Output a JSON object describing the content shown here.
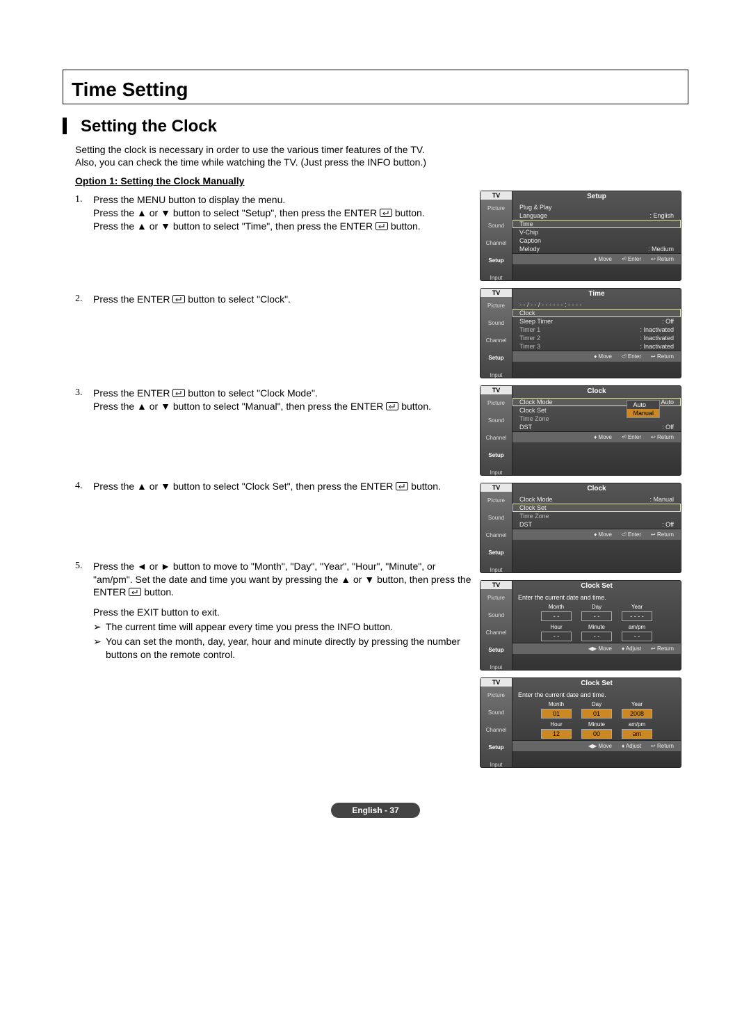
{
  "header": {
    "title": "Time Setting"
  },
  "subheader": {
    "title": "Setting the Clock"
  },
  "intro": {
    "line1": "Setting the clock is necessary in order to use the various timer features of the TV.",
    "line2": "Also, you can check the time while watching the TV. (Just press the INFO button.)"
  },
  "option1": {
    "title": "Option 1: Setting the Clock Manually"
  },
  "steps": {
    "s1": {
      "n": "1.",
      "a": "Press the MENU button to display the menu.",
      "b1": "Press the ▲ or ▼ button to select \"Setup\", then press the ENTER",
      "b2": "button.",
      "c1": "Press the ▲ or ▼ button to select \"Time\", then press the ENTER",
      "c2": "button."
    },
    "s2": {
      "n": "2.",
      "a1": "Press the ENTER",
      "a2": "button to select \"Clock\"."
    },
    "s3": {
      "n": "3.",
      "a1": "Press the ENTER",
      "a2": "button to select \"Clock Mode\".",
      "b1": "Press the ▲ or ▼ button to select \"Manual\", then press the ENTER",
      "b2": "button."
    },
    "s4": {
      "n": "4.",
      "a1": "Press the ▲ or ▼ button to select \"Clock Set\", then press the ENTER",
      "a2": "button."
    },
    "s5": {
      "n": "5.",
      "a": "Press the ◄ or ► button to move to \"Month\", \"Day\", \"Year\", \"Hour\", \"Minute\", or \"am/pm\". Set the date and time you want by pressing the ▲ or ▼ button, then press the ENTER",
      "a2": "button.",
      "b": "Press the EXIT button to exit.",
      "n1": "The current time will appear every time you press the INFO button.",
      "n2": "You can set the month, day, year, hour and minute directly by pressing the number buttons on the remote control."
    }
  },
  "osd": {
    "nav": {
      "tv": "TV",
      "tabs": [
        "Picture",
        "Sound",
        "Channel",
        "Setup",
        "Input"
      ],
      "sel_setup": 3
    },
    "foot": {
      "move": "Move",
      "enter": "Enter",
      "return": "Return",
      "adjust": "Adjust"
    },
    "setup": {
      "title": "Setup",
      "rows": [
        {
          "k": "Plug & Play",
          "v": "",
          "sel": false
        },
        {
          "k": "Language",
          "v": ": English",
          "sel": false
        },
        {
          "k": "Time",
          "v": "",
          "sel": true
        },
        {
          "k": "V-Chip",
          "v": "",
          "sel": false
        },
        {
          "k": "Caption",
          "v": "",
          "sel": false
        },
        {
          "k": "Melody",
          "v": ": Medium",
          "sel": false
        }
      ]
    },
    "time": {
      "title": "Time",
      "header": "- - / - - / - - - -   - - : - -   - -",
      "rows": [
        {
          "k": "Clock",
          "v": "",
          "sel": true
        },
        {
          "k": "Sleep Timer",
          "v": ": Off",
          "sel": false
        },
        {
          "k": "Timer 1",
          "v": ": Inactivated",
          "sel": false,
          "dim": true
        },
        {
          "k": "Timer 2",
          "v": ": Inactivated",
          "sel": false,
          "dim": true
        },
        {
          "k": "Timer 3",
          "v": ": Inactivated",
          "sel": false,
          "dim": true
        }
      ]
    },
    "clock1": {
      "title": "Clock",
      "rows": [
        {
          "k": "Clock Mode",
          "v": ": Auto",
          "sel": true
        },
        {
          "k": "Clock Set",
          "v": "",
          "sel": false
        },
        {
          "k": "Time Zone",
          "v": "",
          "sel": false,
          "dim": true
        },
        {
          "k": "DST",
          "v": ": Off",
          "sel": false
        }
      ],
      "dropdown": {
        "options": [
          "Auto",
          "Manual"
        ],
        "sel": 1
      }
    },
    "clock2": {
      "title": "Clock",
      "rows": [
        {
          "k": "Clock Mode",
          "v": ": Manual",
          "sel": false
        },
        {
          "k": "Clock Set",
          "v": "",
          "sel": true
        },
        {
          "k": "Time Zone",
          "v": "",
          "sel": false,
          "dim": true
        },
        {
          "k": "DST",
          "v": ": Off",
          "sel": false
        }
      ]
    },
    "clockset1": {
      "title": "Clock Set",
      "prompt": "Enter the current date and time.",
      "topLabels": [
        "Month",
        "Day",
        "Year"
      ],
      "topValues": [
        "- -",
        "- -",
        "- - - -"
      ],
      "botLabels": [
        "Hour",
        "Minute",
        "am/pm"
      ],
      "botValues": [
        "- -",
        "- -",
        "- -"
      ]
    },
    "clockset2": {
      "title": "Clock Set",
      "prompt": "Enter the current date and time.",
      "topLabels": [
        "Month",
        "Day",
        "Year"
      ],
      "topValues": [
        "01",
        "01",
        "2008"
      ],
      "botLabels": [
        "Hour",
        "Minute",
        "am/pm"
      ],
      "botValues": [
        "12",
        "00",
        "am"
      ]
    }
  },
  "footer": {
    "pagelabel": "English - 37"
  }
}
